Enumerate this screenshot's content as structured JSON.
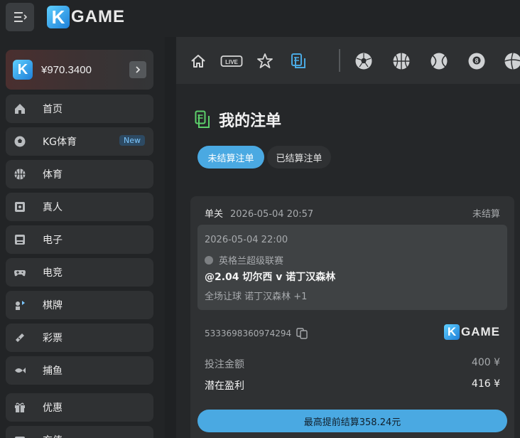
{
  "header": {
    "logo_k": "K",
    "logo_text": "GAME"
  },
  "sidebar": {
    "balance": {
      "amount": "¥970.3400"
    },
    "items": [
      {
        "label": "首页",
        "icon": "home-icon"
      },
      {
        "label": "KG体育",
        "icon": "soccer-icon",
        "badge": "New"
      },
      {
        "label": "体育",
        "icon": "basketball-icon"
      },
      {
        "label": "真人",
        "icon": "cards-icon"
      },
      {
        "label": "电子",
        "icon": "slot-machine-icon"
      },
      {
        "label": "电竞",
        "icon": "gamepad-icon"
      },
      {
        "label": "棋牌",
        "icon": "chess-icon"
      },
      {
        "label": "彩票",
        "icon": "lottery-icon"
      },
      {
        "label": "捕鱼",
        "icon": "fish-icon"
      },
      {
        "label": "优惠",
        "icon": "gift-icon"
      },
      {
        "label": "充值",
        "icon": "deposit-icon"
      }
    ]
  },
  "sport_bar": {
    "icons": [
      "home-icon",
      "live-icon",
      "star-icon",
      "betslip-icon",
      "soccer-icon",
      "basketball-icon",
      "tennis-icon",
      "billiards-icon",
      "volleyball-icon"
    ],
    "live_label": "LIVE"
  },
  "main": {
    "title": "我的注单",
    "tabs": [
      {
        "label": "未结算注单",
        "active": true
      },
      {
        "label": "已结算注单",
        "active": false
      }
    ],
    "bet": {
      "type": "单关",
      "placed_at": "2026-05-04 20:57",
      "status": "未结算",
      "event_time": "2026-05-04 22:00",
      "league": "英格兰超级联赛",
      "match": "@2.04 切尔西 v 诺丁汉森林",
      "selection": "全场让球 诺丁汉森林 +1",
      "bet_id": "5333698360974294",
      "stake_label": "投注金额",
      "stake_value": "400 ¥",
      "profit_label": "潜在盈利",
      "profit_value": "416 ¥",
      "cashout_label": "最高提前结算358.24元"
    }
  },
  "colors": {
    "accent": "#4aa9e2",
    "background": "#1f2123",
    "card": "#2f3133"
  }
}
